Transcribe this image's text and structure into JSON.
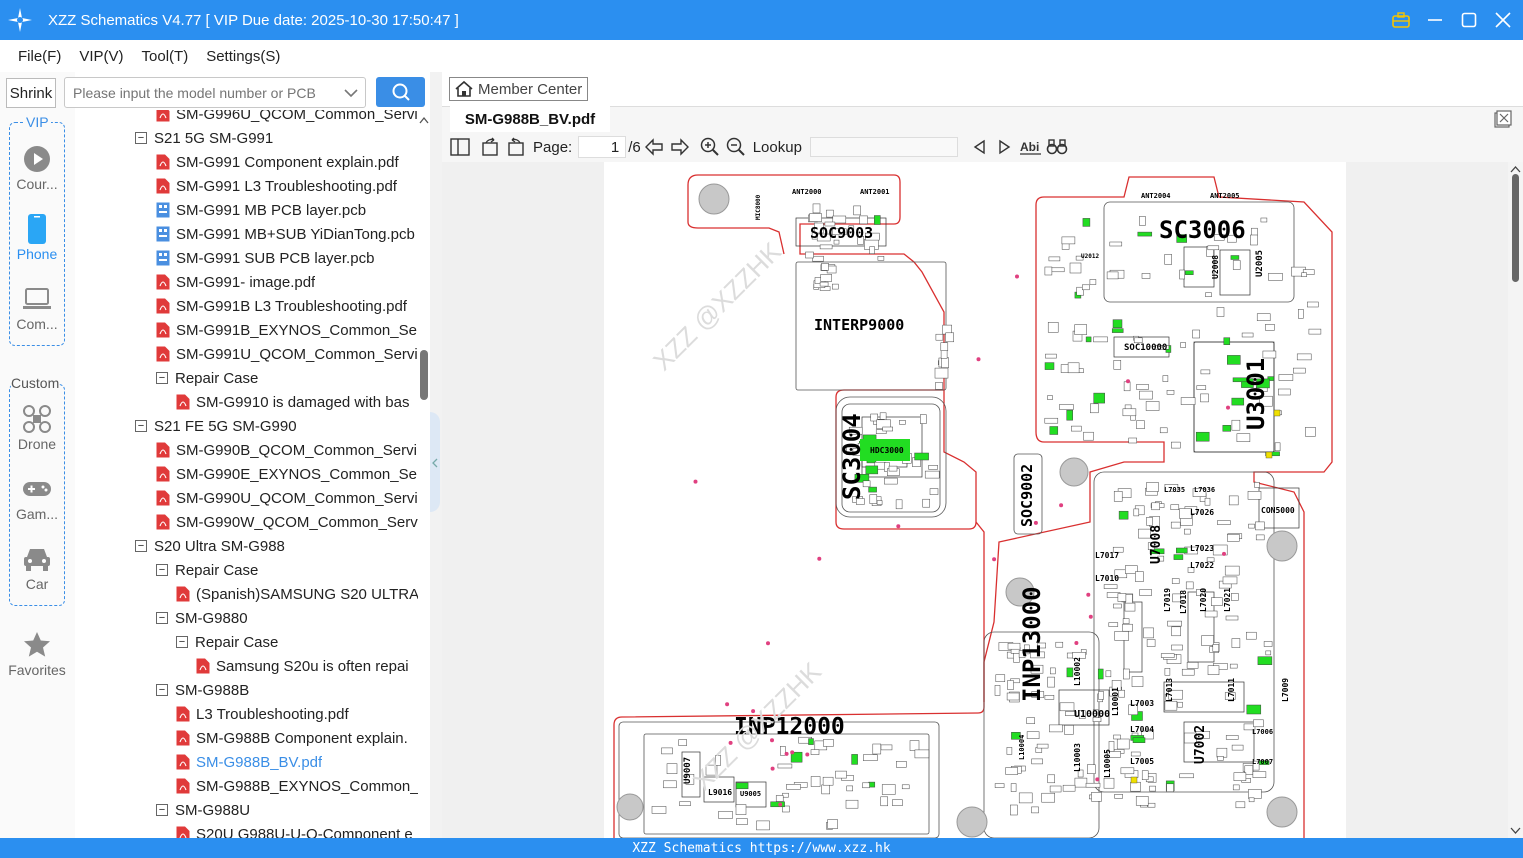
{
  "window": {
    "title": "XZZ Schematics V4.77 [ VIP Due date: 2025-10-30 17:50:47 ]"
  },
  "menu": [
    "File(F)",
    "VIP(V)",
    "Tool(T)",
    "Settings(S)"
  ],
  "search": {
    "shrink_label": "Shrink",
    "placeholder": "Please input the model number or PCB"
  },
  "sidebar": {
    "vip_title": "VIP",
    "custom_title": "Custom",
    "vip_items": [
      {
        "label": "Cour...",
        "icon": "play-icon"
      },
      {
        "label": "Phone",
        "icon": "phone-icon"
      },
      {
        "label": "Com...",
        "icon": "laptop-icon"
      }
    ],
    "custom_items": [
      {
        "label": "Drone",
        "icon": "drone-icon"
      },
      {
        "label": "Gam...",
        "icon": "gamepad-icon"
      },
      {
        "label": "Car",
        "icon": "car-icon"
      }
    ],
    "favorites_label": "Favorites"
  },
  "tree": [
    {
      "level": 2,
      "type": "pdf",
      "label": "SM-G996U_QCOM_Common_Servi"
    },
    {
      "level": 1,
      "type": "folder",
      "label": "S21 5G SM-G991"
    },
    {
      "level": 2,
      "type": "pdf",
      "label": "SM-G991 Component explain.pdf"
    },
    {
      "level": 2,
      "type": "pdf",
      "label": "SM-G991 L3 Troubleshooting.pdf"
    },
    {
      "level": 2,
      "type": "pcb",
      "label": "SM-G991 MB PCB layer.pcb"
    },
    {
      "level": 2,
      "type": "pcb",
      "label": "SM-G991 MB+SUB YiDianTong.pcb"
    },
    {
      "level": 2,
      "type": "pcb",
      "label": "SM-G991 SUB PCB layer.pcb"
    },
    {
      "level": 2,
      "type": "pdf",
      "label": "SM-G991- image.pdf"
    },
    {
      "level": 2,
      "type": "pdf",
      "label": "SM-G991B L3 Troubleshooting.pdf"
    },
    {
      "level": 2,
      "type": "pdf",
      "label": "SM-G991B_EXYNOS_Common_Serv"
    },
    {
      "level": 2,
      "type": "pdf",
      "label": "SM-G991U_QCOM_Common_Servi"
    },
    {
      "level": 2,
      "type": "folder",
      "label": "Repair Case"
    },
    {
      "level": 3,
      "type": "pdf",
      "label": "SM-G9910 is damaged with bas"
    },
    {
      "level": 1,
      "type": "folder",
      "label": "S21 FE 5G SM-G990"
    },
    {
      "level": 2,
      "type": "pdf",
      "label": "SM-G990B_QCOM_Common_Servi"
    },
    {
      "level": 2,
      "type": "pdf",
      "label": "SM-G990E_EXYNOS_Common_Serv"
    },
    {
      "level": 2,
      "type": "pdf",
      "label": "SM-G990U_QCOM_Common_Servi"
    },
    {
      "level": 2,
      "type": "pdf",
      "label": "SM-G990W_QCOM_Common_Servi"
    },
    {
      "level": 1,
      "type": "folder",
      "label": "S20 Ultra SM-G988"
    },
    {
      "level": 2,
      "type": "folder",
      "label": "Repair Case"
    },
    {
      "level": 3,
      "type": "pdf",
      "label": "(Spanish)SAMSUNG S20 ULTRA"
    },
    {
      "level": 2,
      "type": "folder",
      "label": "SM-G9880"
    },
    {
      "level": 3,
      "type": "folder",
      "label": "Repair Case"
    },
    {
      "level": 4,
      "type": "pdf",
      "label": "Samsung S20u is often repai"
    },
    {
      "level": 2,
      "type": "folder",
      "label": "SM-G988B"
    },
    {
      "level": 3,
      "type": "pdf",
      "label": "L3 Troubleshooting.pdf"
    },
    {
      "level": 3,
      "type": "pdf",
      "label": "SM-G988B Component explain."
    },
    {
      "level": 3,
      "type": "pdf",
      "label": "SM-G988B_BV.pdf",
      "selected": true
    },
    {
      "level": 3,
      "type": "pdf",
      "label": "SM-G988B_EXYNOS_Common_S"
    },
    {
      "level": 2,
      "type": "folder",
      "label": "SM-G988U"
    },
    {
      "level": 3,
      "type": "pdf",
      "label": "S20U G988U-U-Q-Component e"
    }
  ],
  "viewer": {
    "member_center": "Member Center",
    "tab_title": "SM-G988B_BV.pdf",
    "page_label": "Page:",
    "page_current": "1",
    "page_total": "/6",
    "lookup_label": "Lookup",
    "lookup_value": ""
  },
  "schematic": {
    "labels": [
      "SOC9003",
      "INTERP9000",
      "SC3004",
      "SOC9002",
      "INP13000",
      "INP12000",
      "SC3006",
      "U3001",
      "SOC10000",
      "U7008",
      "U7002",
      "U10000",
      "HDC3000",
      "CON5000",
      "L9016",
      "U9005",
      "U9007",
      "MIC8000",
      "ANT2000",
      "ANT2001",
      "ANT2004",
      "ANT2005",
      "U2005",
      "U2008",
      "U2012",
      "L7003",
      "L7004",
      "L7005",
      "L7010",
      "L7017",
      "L7022",
      "L7023",
      "L7026",
      "L7035",
      "L7036",
      "L7018",
      "L7019",
      "L7020",
      "L7021",
      "L7011",
      "L7013",
      "L7009",
      "L7006",
      "L7007",
      "L10001",
      "L10002",
      "L10003",
      "L10004",
      "L10005"
    ],
    "watermark": "XZZ @XZZHK"
  },
  "status": {
    "text": "XZZ Schematics https://www.xzz.hk"
  },
  "colors": {
    "accent": "#2b8ff0",
    "board_outline": "#d93030",
    "component_green": "#22dd22"
  }
}
